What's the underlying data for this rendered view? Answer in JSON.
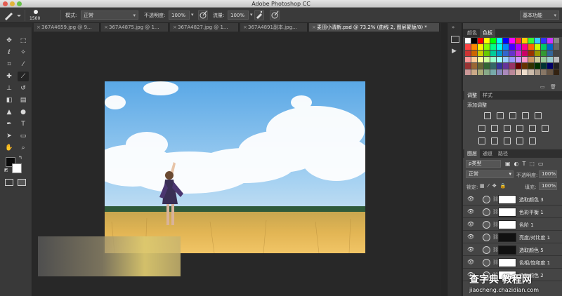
{
  "window": {
    "title": "Adobe Photoshop CC"
  },
  "options_bar": {
    "brush_size": "1500",
    "mode_label": "模式:",
    "mode_value": "正常",
    "opacity_label": "不透明度:",
    "opacity_value": "100%",
    "flow_label": "流量:",
    "flow_value": "100%",
    "workspace": "基本功能"
  },
  "tabs": [
    {
      "label": "367A4659.jpg @ 9...",
      "active": false
    },
    {
      "label": "367A4875.jpg @ 1...",
      "active": false
    },
    {
      "label": "367A4827.jpg @ 1...",
      "active": false
    },
    {
      "label": "367A4891副本.jpg...",
      "active": false
    },
    {
      "label": "麦田小清新.psd @ 73.2% (曲线 2, 图层蒙版/8) *",
      "active": true
    }
  ],
  "tools": [
    {
      "name": "move-tool-icon",
      "glyph": "✥"
    },
    {
      "name": "marquee-tool-icon",
      "glyph": "⬚"
    },
    {
      "name": "lasso-tool-icon",
      "glyph": "ℓ"
    },
    {
      "name": "magic-wand-tool-icon",
      "glyph": "✧"
    },
    {
      "name": "crop-tool-icon",
      "glyph": "⌗"
    },
    {
      "name": "eyedropper-tool-icon",
      "glyph": "⁄"
    },
    {
      "name": "healing-brush-tool-icon",
      "glyph": "✚"
    },
    {
      "name": "brush-tool-icon",
      "glyph": "⟋"
    },
    {
      "name": "clone-stamp-tool-icon",
      "glyph": "⊥"
    },
    {
      "name": "history-brush-tool-icon",
      "glyph": "↺"
    },
    {
      "name": "eraser-tool-icon",
      "glyph": "◧"
    },
    {
      "name": "gradient-tool-icon",
      "glyph": "▤"
    },
    {
      "name": "blur-tool-icon",
      "glyph": "▲"
    },
    {
      "name": "dodge-tool-icon",
      "glyph": "●"
    },
    {
      "name": "pen-tool-icon",
      "glyph": "✒"
    },
    {
      "name": "type-tool-icon",
      "glyph": "T"
    },
    {
      "name": "path-selection-tool-icon",
      "glyph": "➤"
    },
    {
      "name": "shape-tool-icon",
      "glyph": "▭"
    },
    {
      "name": "hand-tool-icon",
      "glyph": "✋"
    },
    {
      "name": "zoom-tool-icon",
      "glyph": "⌕"
    }
  ],
  "swatches_panel": {
    "tabs": [
      "颜色",
      "色板"
    ]
  },
  "adjustments_panel": {
    "tabs": [
      "调整",
      "样式"
    ],
    "heading": "添加调整"
  },
  "layers_panel": {
    "tabs": [
      "图层",
      "通道",
      "路径"
    ],
    "filter_kind": "ρ类型",
    "blend_mode": "正常",
    "opacity_label": "不透明度:",
    "opacity_value": "100%",
    "lock_label": "锁定:",
    "fill_label": "填充:",
    "fill_value": "100%",
    "layers": [
      {
        "name": "选取颜色 3",
        "mask": "white"
      },
      {
        "name": "色彩平衡 1",
        "mask": "white"
      },
      {
        "name": "色阶 1",
        "mask": "white"
      },
      {
        "name": "亮度/对比度 1",
        "mask": "dark"
      },
      {
        "name": "选取颜色 5",
        "mask": "dark"
      },
      {
        "name": "色相/饱和度 1",
        "mask": "white"
      },
      {
        "name": "选取颜色 2",
        "mask": "white"
      }
    ]
  },
  "watermark": {
    "text": "查字典 教程网",
    "url": "jiaocheng.chazidian.com"
  },
  "colors": {
    "foreground": "#0a0a0a",
    "background": "#ffffff",
    "swatches": [
      "#ffffff",
      "#000000",
      "#ff0000",
      "#ffff00",
      "#00ff00",
      "#00ffff",
      "#0000ff",
      "#ff00ff",
      "#ff3333",
      "#ffcc00",
      "#33ff33",
      "#33ccff",
      "#3333ff",
      "#cc33ff",
      "#888888",
      "#ff4444",
      "#ff8800",
      "#ffee00",
      "#88ff00",
      "#00ff88",
      "#00ffee",
      "#0088ff",
      "#4400ff",
      "#aa00ff",
      "#ff0088",
      "#ff6600",
      "#ccff00",
      "#00cc66",
      "#0066cc",
      "#666666",
      "#cc3333",
      "#cc6600",
      "#cccc00",
      "#66cc00",
      "#00cc99",
      "#0099cc",
      "#3366cc",
      "#6633cc",
      "#cc33cc",
      "#cc0066",
      "#993300",
      "#999900",
      "#339933",
      "#336699",
      "#444444",
      "#ff9999",
      "#ffcc99",
      "#ffff99",
      "#ccff99",
      "#99ffcc",
      "#99ffff",
      "#99ccff",
      "#9999ff",
      "#cc99ff",
      "#ff99cc",
      "#cc9966",
      "#cccc99",
      "#99cc99",
      "#99cccc",
      "#bbbbbb",
      "#993333",
      "#996633",
      "#666633",
      "#336633",
      "#336666",
      "#333399",
      "#663399",
      "#993366",
      "#660000",
      "#663300",
      "#333300",
      "#003300",
      "#003333",
      "#000066",
      "#222222",
      "#cc9999",
      "#ccaa88",
      "#aaaa77",
      "#88aa88",
      "#77aaaa",
      "#8888bb",
      "#aa88bb",
      "#bb8899",
      "#ddbbaa",
      "#eeddcc",
      "#ccbbaa",
      "#aa9988",
      "#887766",
      "#665544",
      "#332211"
    ]
  }
}
